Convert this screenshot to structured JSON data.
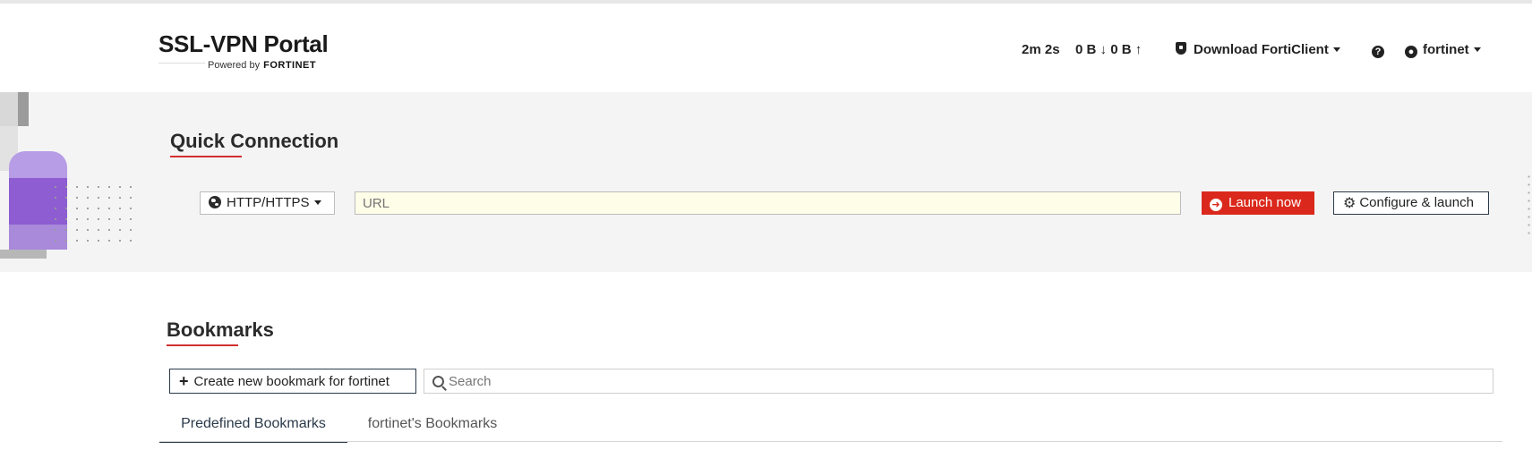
{
  "header": {
    "title": "SSL-VPN Portal",
    "powered_by": "Powered by",
    "brand_logo": "FORTINET",
    "session_time": "2m 2s",
    "bytes_down": "0 B",
    "bytes_up": "0 B",
    "download_label": "Download FortiClient",
    "help_icon": "question-circle-icon",
    "user_label": "fortinet"
  },
  "quick_connection": {
    "title": "Quick Connection",
    "protocol": "HTTP/HTTPS",
    "url_placeholder": "URL",
    "launch_label": "Launch now",
    "configure_label": "Configure & launch"
  },
  "bookmarks": {
    "title": "Bookmarks",
    "create_label": "Create new bookmark for fortinet",
    "search_placeholder": "Search",
    "tabs": [
      {
        "label": "Predefined Bookmarks",
        "active": true
      },
      {
        "label": "fortinet's Bookmarks",
        "active": false
      }
    ]
  },
  "colors": {
    "accent": "#da291c",
    "section_bg": "#f4f4f4",
    "url_bg": "#fdfde8",
    "deco_purple": "#8d5dd1"
  }
}
